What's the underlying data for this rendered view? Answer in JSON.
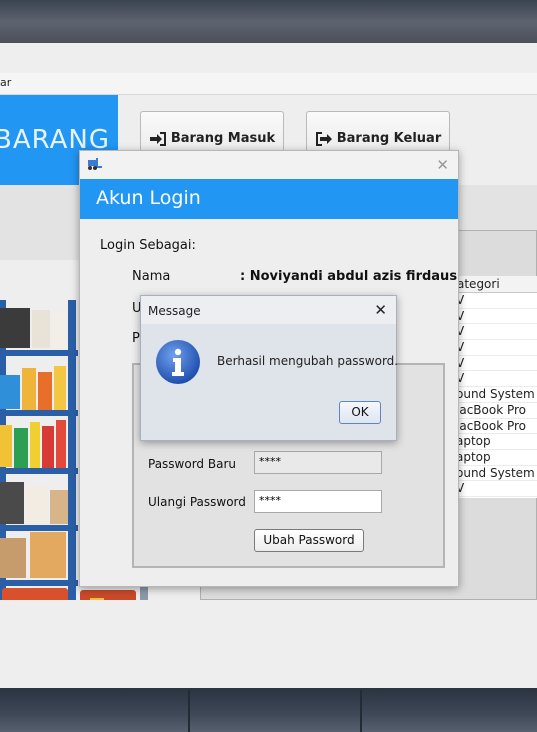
{
  "main_window": {
    "menubar_text": "ar",
    "header_title": "BARANG",
    "barang_masuk_label": "Barang Masuk",
    "barang_keluar_label": "Barang Keluar",
    "table": {
      "column_header": "ategori",
      "rows": [
        "V",
        "V",
        "V",
        "V",
        "V",
        "V",
        "ound System",
        "lacBook Pro",
        "lacBook Pro",
        "aptop",
        "aptop",
        "ound System",
        "V"
      ]
    }
  },
  "login_dialog": {
    "banner_title": "Akun Login",
    "login_sebagai_label": "Login Sebagai:",
    "nama_label": "Nama",
    "nama_value": ": Noviyandi abdul azis firdaus",
    "username_label_partial": "U",
    "password_label_partial": "P",
    "password_baru_label": "Password Baru",
    "password_baru_value": "****",
    "ulangi_password_label": "Ulangi Password",
    "ulangi_password_value": "****",
    "ubah_password_button": "Ubah Password"
  },
  "message_dialog": {
    "title": "Message",
    "icon": "info-icon",
    "text": "Berhasil mengubah password.",
    "ok_button": "OK"
  },
  "colors": {
    "accent_blue": "#2196f3",
    "info_icon_blue": "#2f64c4"
  }
}
